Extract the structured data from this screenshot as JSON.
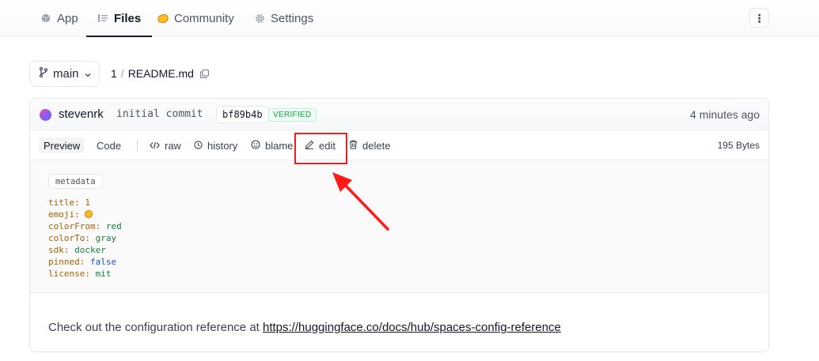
{
  "tabs": [
    {
      "label": "App",
      "icon": "app-cube-icon"
    },
    {
      "label": "Files",
      "icon": "files-list-icon",
      "active": true
    },
    {
      "label": "Community",
      "icon": "community-blob-icon"
    },
    {
      "label": "Settings",
      "icon": "gear-icon"
    }
  ],
  "more_menu": {
    "icon": "kebab-menu-icon",
    "label": "⋮"
  },
  "breadcrumb": {
    "branch": "main",
    "repo": "1",
    "separator": "/",
    "file": "README.md"
  },
  "commit": {
    "author": "stevenrk",
    "message": "initial commit",
    "sha": "bf89b4b",
    "verified": "VERIFIED",
    "time": "4 minutes ago"
  },
  "toolbar": {
    "preview": "Preview",
    "code": "Code",
    "raw": "raw",
    "history": "history",
    "blame": "blame",
    "edit": "edit",
    "delete": "delete",
    "size": "195 Bytes"
  },
  "metadata": {
    "tag": "metadata",
    "lines": [
      {
        "key": "title:",
        "value": "1",
        "kind": "num"
      },
      {
        "key": "emoji:",
        "value": "",
        "kind": "emoji"
      },
      {
        "key": "colorFrom:",
        "value": "red",
        "kind": "str"
      },
      {
        "key": "colorTo:",
        "value": "gray",
        "kind": "str"
      },
      {
        "key": "sdk:",
        "value": "docker",
        "kind": "str"
      },
      {
        "key": "pinned:",
        "value": "false",
        "kind": "bool"
      },
      {
        "key": "license:",
        "value": "mit",
        "kind": "str"
      }
    ]
  },
  "readme": {
    "text": "Check out the configuration reference at ",
    "link": "https://huggingface.co/docs/hub/spaces-config-reference"
  },
  "colors": {
    "highlight": "#ff1a1a",
    "verified": "#16a34a",
    "link": "#111827"
  }
}
